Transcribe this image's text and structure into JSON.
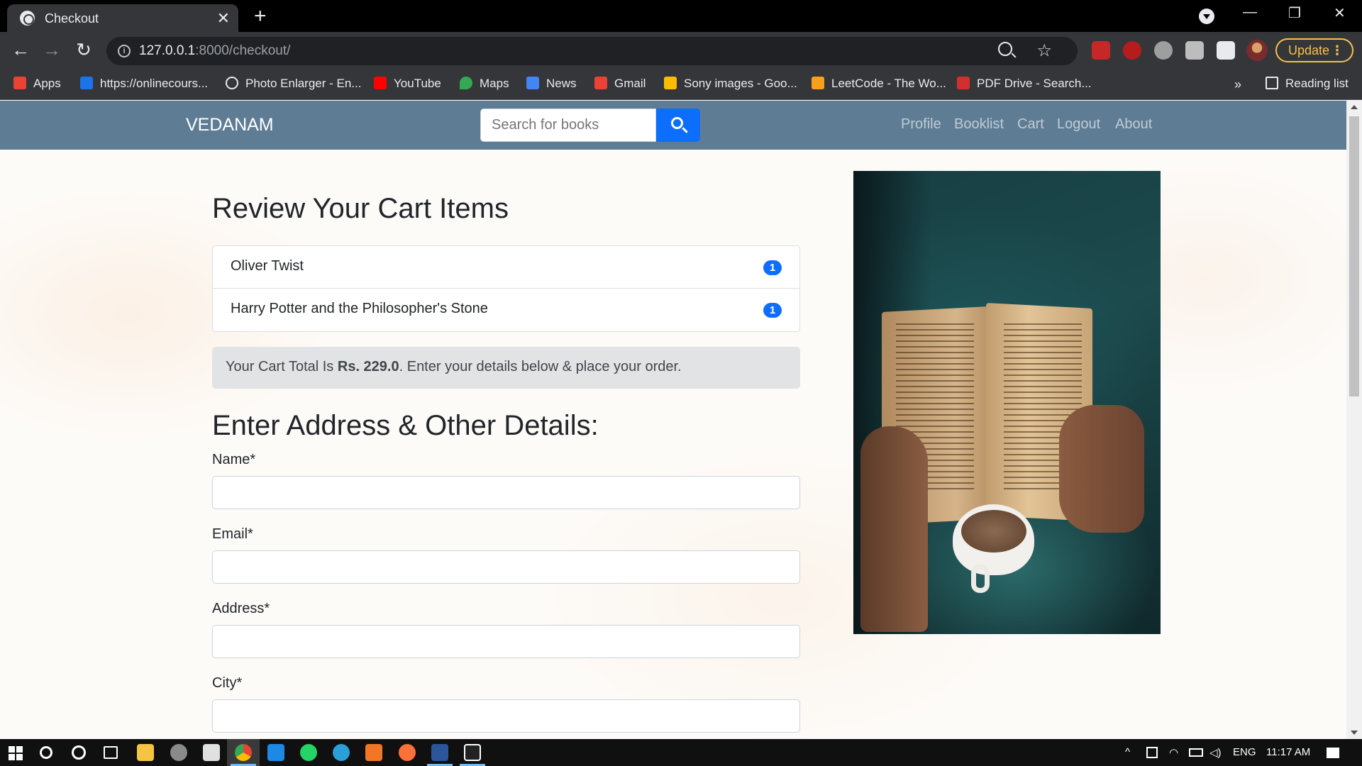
{
  "browser": {
    "tab_title": "Checkout",
    "tab_close": "✕",
    "new_tab": "+",
    "url_host": "127.0.0.1",
    "url_rest": ":8000/checkout/",
    "update_label": "Update",
    "more_dots": "⋮",
    "window_controls": {
      "minimize": "—",
      "restore": "❐",
      "close": "✕"
    }
  },
  "bookmarks": [
    {
      "label": "Apps",
      "icon": "apps-grid-icon",
      "color": "#ea4335"
    },
    {
      "label": "https://onlinecours...",
      "icon": "s-logo-icon",
      "color": "#1a73e8"
    },
    {
      "label": "Photo Enlarger - En...",
      "icon": "magnifier-icon",
      "color": "#e8eaed"
    },
    {
      "label": "YouTube",
      "icon": "youtube-icon",
      "color": "#ff0000"
    },
    {
      "label": "Maps",
      "icon": "maps-pin-icon",
      "color": "#34a853"
    },
    {
      "label": "News",
      "icon": "news-icon",
      "color": "#4285f4"
    },
    {
      "label": "Gmail",
      "icon": "gmail-icon",
      "color": "#ea4335"
    },
    {
      "label": "Sony images - Goo...",
      "icon": "drive-icon",
      "color": "#fbbc04"
    },
    {
      "label": "LeetCode - The Wo...",
      "icon": "leetcode-icon",
      "color": "#f89f1b"
    },
    {
      "label": "PDF Drive - Search...",
      "icon": "pdf-drive-icon",
      "color": "#d32f2f"
    }
  ],
  "bookmarks_more": "»",
  "reading_list": "Reading list",
  "site": {
    "brand": "VEDANAM",
    "search_placeholder": "Search for books",
    "nav": [
      "Profile",
      "Booklist",
      "Cart",
      "Logout",
      "About"
    ]
  },
  "cart": {
    "heading": "Review Your Cart Items",
    "items": [
      {
        "title": "Oliver Twist",
        "qty": "1"
      },
      {
        "title": "Harry Potter and the Philosopher's Stone",
        "qty": "1"
      }
    ],
    "total_prefix": "Your Cart Total Is ",
    "total_amount": "Rs. 229.0",
    "total_suffix": ". Enter your details below & place your order."
  },
  "form": {
    "heading": "Enter Address & Other Details:",
    "fields": [
      {
        "label": "Name*",
        "value": ""
      },
      {
        "label": "Email*",
        "value": ""
      },
      {
        "label": "Address*",
        "value": ""
      },
      {
        "label": "City*",
        "value": ""
      }
    ]
  },
  "taskbar": {
    "language": "ENG",
    "time": "11:17 AM"
  }
}
